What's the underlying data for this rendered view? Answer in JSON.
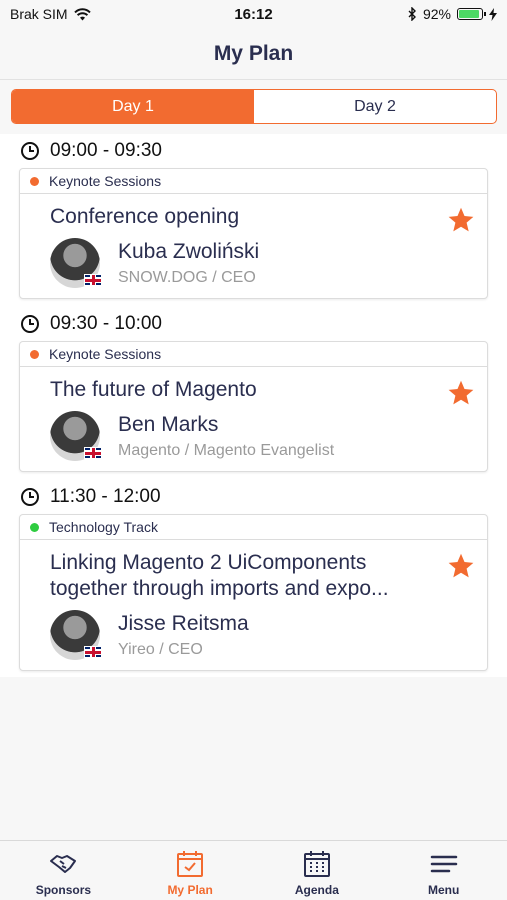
{
  "status_bar": {
    "carrier": "Brak SIM",
    "time": "16:12",
    "battery_percent": "92%",
    "battery_level": 0.92
  },
  "nav": {
    "title": "My Plan"
  },
  "day_tabs": [
    {
      "label": "Day 1",
      "active": true
    },
    {
      "label": "Day 2",
      "active": false
    }
  ],
  "slots": [
    {
      "time": "09:00 - 09:30",
      "track": "Keynote Sessions",
      "track_color": "#f26b30",
      "title": "Conference opening",
      "speaker_name": "Kuba Zwoliński",
      "speaker_org": "SNOW.DOG / CEO"
    },
    {
      "time": "09:30 - 10:00",
      "track": "Keynote Sessions",
      "track_color": "#f26b30",
      "title": "The future of Magento",
      "speaker_name": "Ben Marks",
      "speaker_org": "Magento / Magento Evangelist"
    },
    {
      "time": "11:30 - 12:00",
      "track": "Technology Track",
      "track_color": "#2ecc40",
      "title": "Linking Magento 2 UiComponents together through imports and expo...",
      "speaker_name": "Jisse Reitsma",
      "speaker_org": "Yireo / CEO"
    }
  ],
  "tab_bar": [
    {
      "label": "Sponsors",
      "icon": "handshake-icon",
      "active": false
    },
    {
      "label": "My Plan",
      "icon": "calendar-check-icon",
      "active": true
    },
    {
      "label": "Agenda",
      "icon": "calendar-grid-icon",
      "active": false
    },
    {
      "label": "Menu",
      "icon": "hamburger-icon",
      "active": false
    }
  ],
  "colors": {
    "accent": "#f26b30",
    "text": "#2a2e4f",
    "muted": "#9a9a9a"
  }
}
